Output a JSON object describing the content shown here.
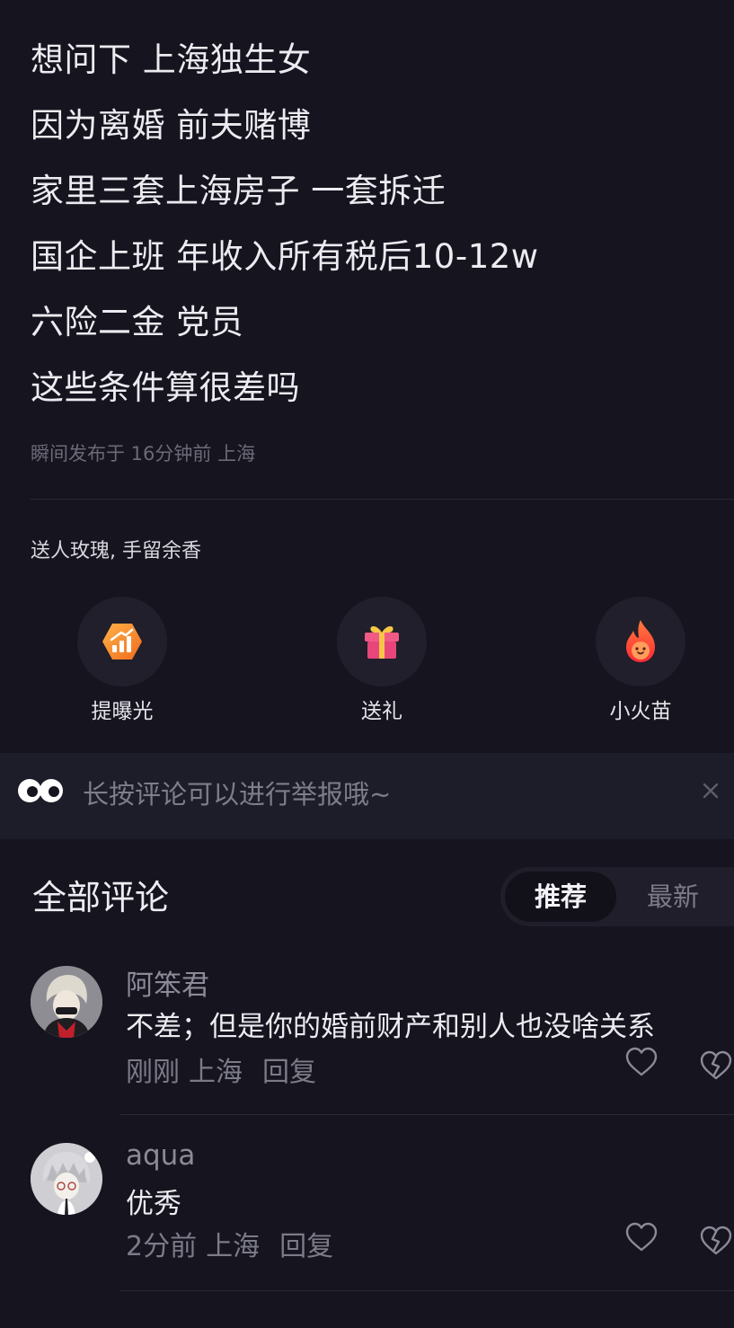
{
  "post": {
    "lines": [
      "想问下 上海独生女",
      "因为离婚 前夫赌博",
      "家里三套上海房子 一套拆迁",
      "国企上班 年收入所有税后10-12w",
      "六险二金  党员",
      "这些条件算很差吗"
    ],
    "meta": "瞬间发布于 16分钟前 上海"
  },
  "gifts": {
    "caption": "送人玫瑰, 手留余香",
    "items": [
      {
        "label": "提曝光",
        "icon": "boost-exposure-icon"
      },
      {
        "label": "送礼",
        "icon": "gift-box-icon"
      },
      {
        "label": "小火苗",
        "icon": "flame-icon"
      }
    ]
  },
  "notice": {
    "text": "长按评论可以进行举报哦~",
    "icon": "eyes-icon",
    "close_icon": "close-icon"
  },
  "comments_header": {
    "title": "全部评论",
    "sort_options": [
      "推荐",
      "最新"
    ],
    "active_sort": "推荐"
  },
  "comments": [
    {
      "name": "阿笨君",
      "text": "不差；但是你的婚前财产和别人也没啥关系",
      "time": "刚刚",
      "location": "上海",
      "reply_label": "回复"
    },
    {
      "name": "aqua",
      "text": "优秀",
      "time": "2分前",
      "location": "上海",
      "reply_label": "回复"
    }
  ],
  "colors": {
    "background": "#15141f",
    "notice_bg": "#1d1c29",
    "muted_text": "#7c7b88",
    "primary_text": "#ecebf0",
    "boost_orange": "#f48a2c",
    "gift_pink": "#f25a86",
    "flame_red": "#ff3d2e"
  }
}
